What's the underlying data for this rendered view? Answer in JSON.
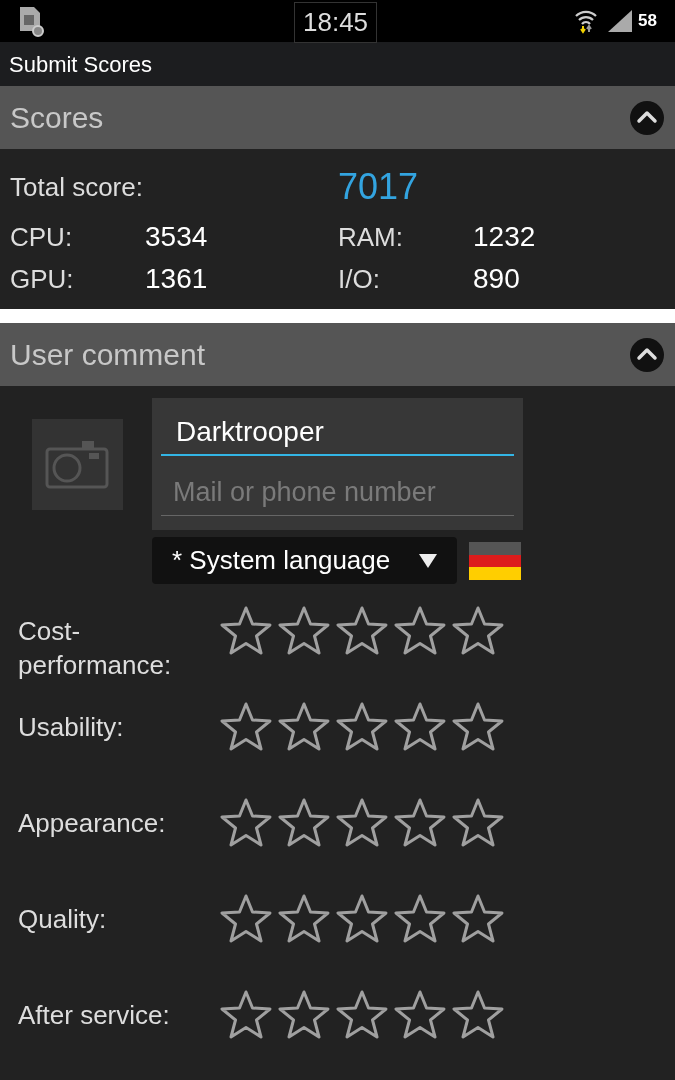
{
  "status_bar": {
    "time": "18:45",
    "battery": "58"
  },
  "app_bar": {
    "title": "Submit Scores"
  },
  "scores": {
    "title": "Scores",
    "expanded": true,
    "total_label": "Total score:",
    "total_value": "7017",
    "items": [
      {
        "label": "CPU:",
        "value": "3534"
      },
      {
        "label": "RAM:",
        "value": "1232"
      },
      {
        "label": "GPU:",
        "value": "1361"
      },
      {
        "label": "I/O:",
        "value": "890"
      }
    ]
  },
  "comment": {
    "title": "User comment",
    "expanded": true,
    "name_field": {
      "value": "Darktrooper"
    },
    "contact_field": {
      "placeholder": "Mail or phone number"
    },
    "language": "* System language",
    "ratings": [
      {
        "label": "Cost-\nperformance:",
        "stars": 0
      },
      {
        "label": "Usability:",
        "stars": 0
      },
      {
        "label": "Appearance:",
        "stars": 0
      },
      {
        "label": "Quality:",
        "stars": 0
      },
      {
        "label": "After service:",
        "stars": 0
      }
    ]
  }
}
